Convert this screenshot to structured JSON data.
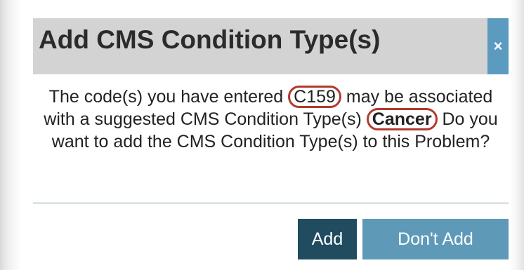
{
  "dialog": {
    "title": "Add CMS Condition Type(s)",
    "close_label": "×",
    "message_part1": "The code(s) you have entered ",
    "code": "C159",
    "message_part2": " may be associated with a suggested CMS Condition Type(s) ",
    "condition": "Cancer",
    "message_part3": " Do you want to add the CMS Condition Type(s) to this Problem?"
  },
  "buttons": {
    "add_label": "Add",
    "dont_add_label": "Don't Add"
  },
  "colors": {
    "header_bg": "#d3d3d3",
    "close_bg": "#5b9bbf",
    "add_bg": "#214b5f",
    "dont_add_bg": "#5e9ab8",
    "annotation_circle": "#b13a2d"
  }
}
